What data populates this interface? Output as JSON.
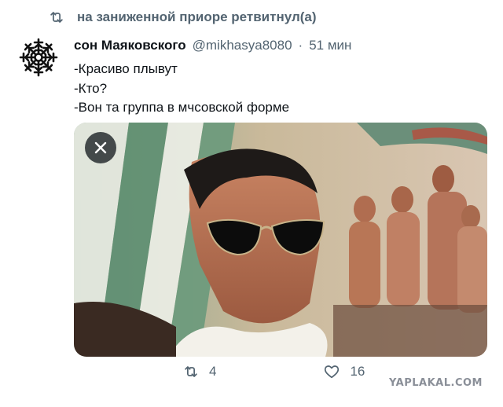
{
  "retweet": {
    "label": "на заниженной приоре ретвитнул(а)"
  },
  "tweet": {
    "author_name": "сон Маяковского",
    "handle": "@mikhasya8080",
    "separator": "·",
    "time": "51 мин",
    "lines": [
      "-Красиво плывут",
      "-Кто?",
      "-Вон та группа в мчсовской форме"
    ],
    "retweet_count": "4",
    "like_count": "16"
  },
  "watermark": "YAPLAKAL.COM",
  "icons": {
    "retweet": "retweet-icon",
    "avatar": "helm-of-awe-icon",
    "close": "close-icon",
    "like": "heart-icon"
  },
  "colors": {
    "text": "#0f1419",
    "secondary": "#536471"
  }
}
